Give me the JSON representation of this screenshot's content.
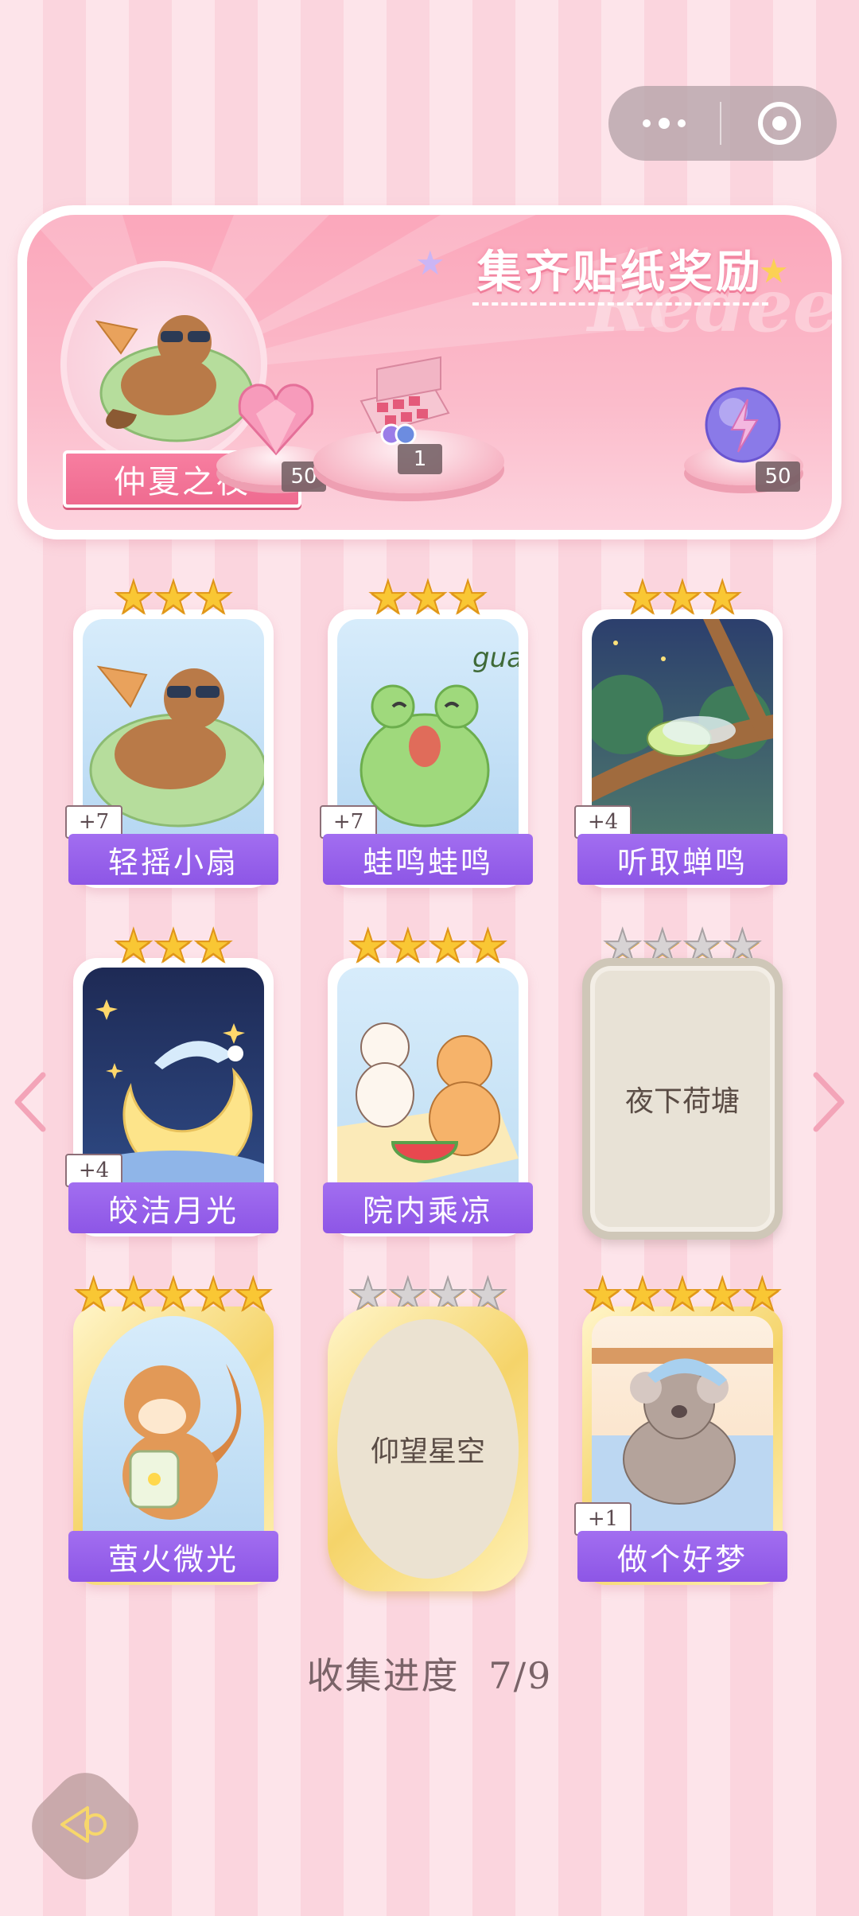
{
  "capsule": {
    "more_icon": "more-dots-icon",
    "close_icon": "close-target-icon"
  },
  "banner": {
    "title": "集齐贴纸奖励",
    "watermark": "Redeem",
    "collection_name": "仲夏之夜",
    "rewards": [
      {
        "icon": "pink-heart-gem-icon",
        "count": "50"
      },
      {
        "icon": "gift-box-icon",
        "count": "1"
      },
      {
        "icon": "purple-energy-orb-icon",
        "count": "50"
      }
    ]
  },
  "stickers": [
    {
      "name": "轻摇小扇",
      "stars": 3,
      "bonus": "+7",
      "unlocked": true
    },
    {
      "name": "蛙鸣蛙鸣",
      "stars": 3,
      "bonus": "+7",
      "unlocked": true
    },
    {
      "name": "听取蝉鸣",
      "stars": 3,
      "bonus": "+4",
      "unlocked": true
    },
    {
      "name": "皎洁月光",
      "stars": 3,
      "bonus": "+4",
      "unlocked": true
    },
    {
      "name": "院内乘凉",
      "stars": 4,
      "bonus": "",
      "unlocked": true
    },
    {
      "name": "夜下荷塘",
      "stars": 4,
      "bonus": "",
      "unlocked": false
    },
    {
      "name": "萤火微光",
      "stars": 5,
      "bonus": "",
      "unlocked": true
    },
    {
      "name": "仰望星空",
      "stars": 4,
      "bonus": "",
      "unlocked": false
    },
    {
      "name": "做个好梦",
      "stars": 5,
      "bonus": "+1",
      "unlocked": true
    }
  ],
  "frog_text": "gua",
  "progress": {
    "label": "收集进度",
    "value": "7/9"
  },
  "nav": {
    "left_icon": "chevron-left-icon",
    "right_icon": "chevron-right-icon",
    "back_icon": "back-arrow-icon"
  }
}
